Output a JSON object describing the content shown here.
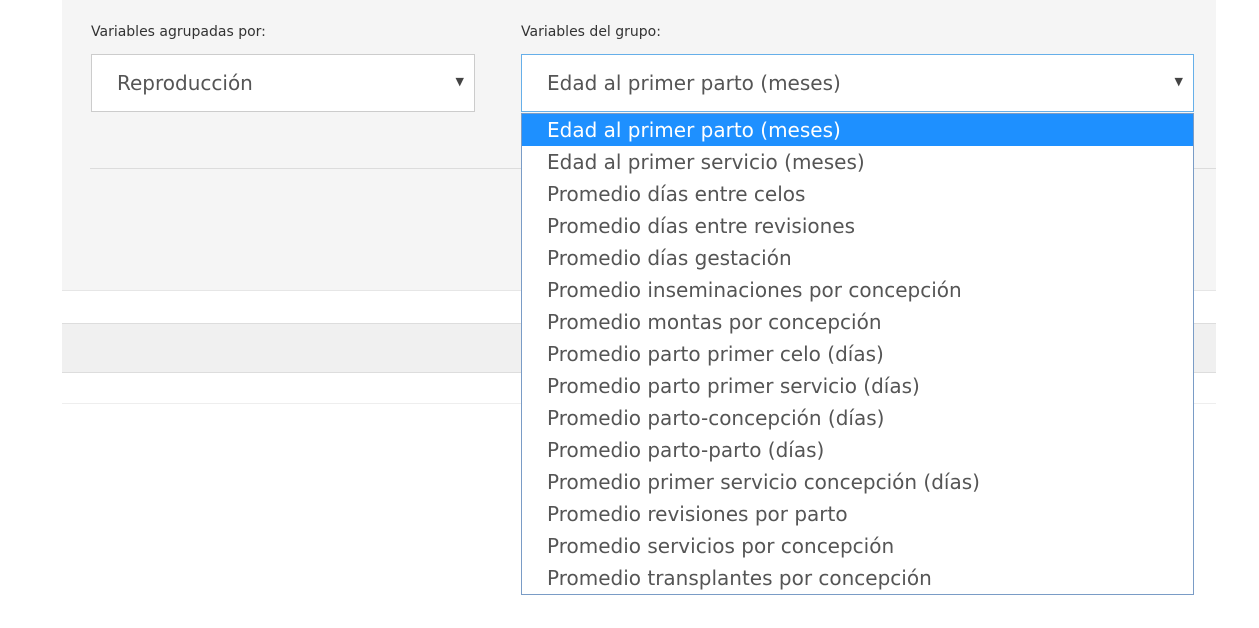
{
  "filters": {
    "group_by": {
      "label": "Variables agrupadas por:",
      "value": "Reproducción"
    },
    "group_variables": {
      "label": "Variables del grupo:",
      "value": "Edad al primer parto (meses)",
      "options": [
        "Edad al primer parto (meses)",
        "Edad al primer servicio (meses)",
        "Promedio días entre celos",
        "Promedio días entre revisiones",
        "Promedio días gestación",
        "Promedio inseminaciones por concepción",
        "Promedio montas por concepción",
        "Promedio parto primer celo (días)",
        "Promedio parto primer servicio (días)",
        "Promedio parto-concepción (días)",
        "Promedio parto-parto (días)",
        "Promedio primer servicio concepción (días)",
        "Promedio revisiones por parto",
        "Promedio servicios por concepción",
        "Promedio transplantes por concepción"
      ],
      "selected_index": 0
    }
  },
  "icons": {
    "caret": "caret-down-icon"
  },
  "colors": {
    "highlight": "#1e90ff",
    "focus_border": "#66afe9"
  }
}
